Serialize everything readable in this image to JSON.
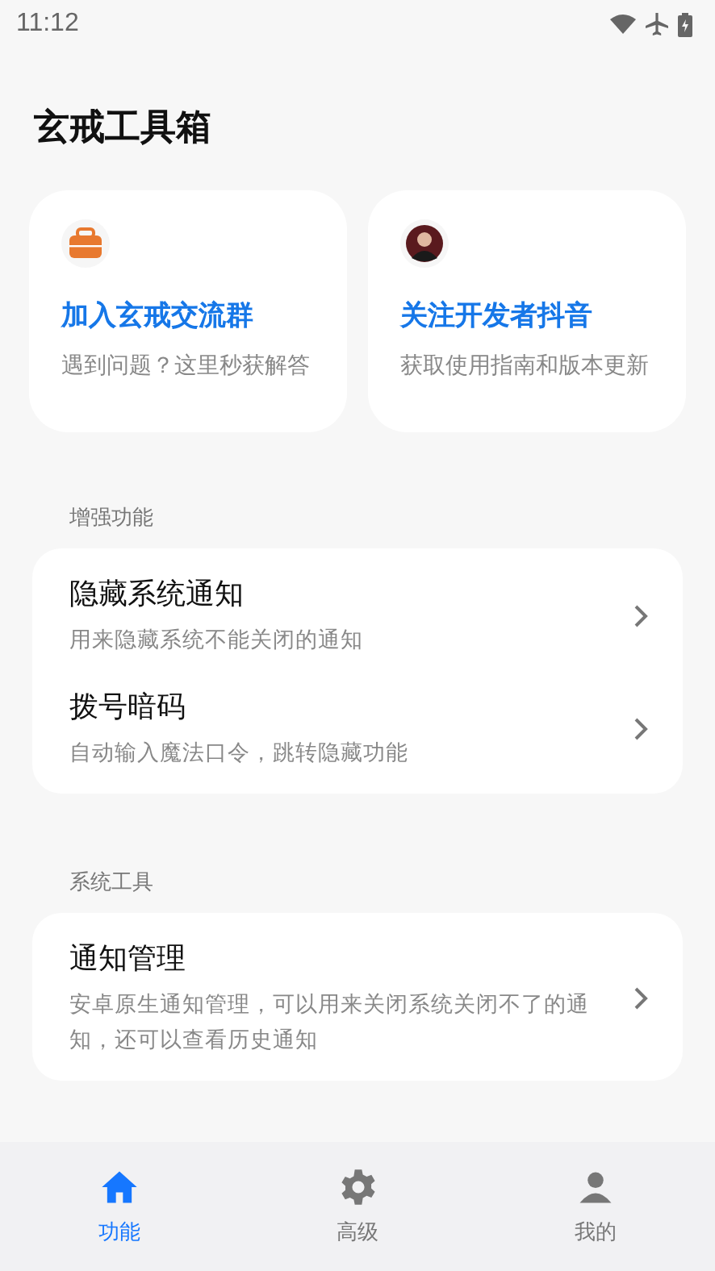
{
  "status_bar": {
    "time": "11:12"
  },
  "title": "玄戒工具箱",
  "quick_cards": [
    {
      "kind": "toolbox",
      "title": "加入玄戒交流群",
      "subtitle": "遇到问题？这里秒获解答"
    },
    {
      "kind": "avatar",
      "title": "关注开发者抖音",
      "subtitle": "获取使用指南和版本更新"
    }
  ],
  "sections": [
    {
      "header": "增强功能",
      "items": [
        {
          "title": "隐藏系统通知",
          "subtitle": "用来隐藏系统不能关闭的通知"
        },
        {
          "title": "拨号暗码",
          "subtitle": "自动输入魔法口令，跳转隐藏功能"
        }
      ]
    },
    {
      "header": "系统工具",
      "items": [
        {
          "title": "通知管理",
          "subtitle": "安卓原生通知管理，可以用来关闭系统关闭不了的通知，还可以查看历史通知"
        }
      ]
    }
  ],
  "bottom_nav": [
    {
      "kind": "home",
      "label": "功能",
      "selected": true
    },
    {
      "kind": "gear",
      "label": "高级",
      "selected": false
    },
    {
      "kind": "person",
      "label": "我的",
      "selected": false
    }
  ]
}
